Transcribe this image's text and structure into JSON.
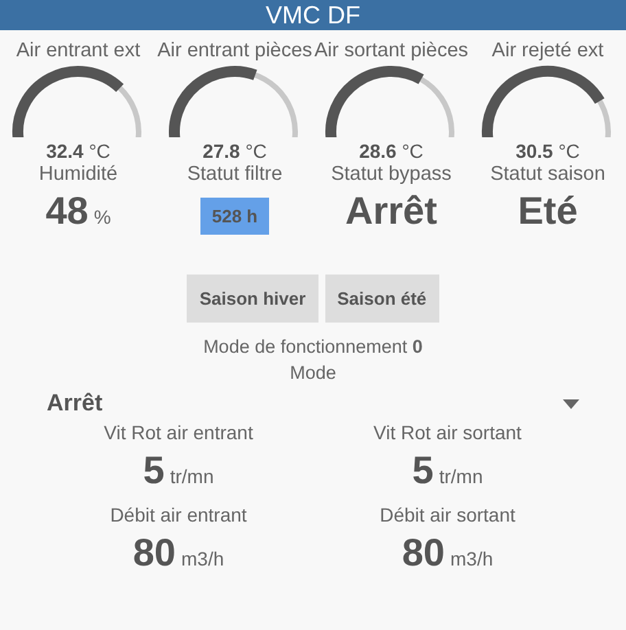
{
  "header": {
    "title": "VMC DF"
  },
  "gauges": [
    {
      "label": "Air entrant ext",
      "level": 0.72,
      "value": "32.4",
      "unit": "°C"
    },
    {
      "label": "Air entrant pièces",
      "level": 0.6,
      "value": "27.8",
      "unit": "°C"
    },
    {
      "label": "Air sortant pièces",
      "level": 0.65,
      "value": "28.6",
      "unit": "°C"
    },
    {
      "label": "Air rejeté ext",
      "level": 0.8,
      "value": "30.5",
      "unit": "°C"
    }
  ],
  "statuses": [
    {
      "label": "Humidité",
      "kind": "value",
      "value": "48",
      "unit": "%"
    },
    {
      "label": "Statut filtre",
      "kind": "badge",
      "value": "528 h"
    },
    {
      "label": "Statut bypass",
      "kind": "text",
      "value": "Arrêt"
    },
    {
      "label": "Statut saison",
      "kind": "text",
      "value": "Eté"
    }
  ],
  "buttons": [
    "Saison hiver",
    "Saison été"
  ],
  "mode_status": "Mode de fonctionnement **0**",
  "mode": {
    "label": "Mode",
    "value": "Arrêt"
  },
  "readings": [
    {
      "label": "Vit Rot air entrant",
      "value": "5",
      "unit": "tr/mn"
    },
    {
      "label": "Vit Rot air sortant",
      "value": "5",
      "unit": "tr/mn"
    },
    {
      "label": "Débit air entrant",
      "value": "80",
      "unit": "m3/h"
    },
    {
      "label": "Débit air sortant",
      "value": "80",
      "unit": "m3/h"
    }
  ]
}
